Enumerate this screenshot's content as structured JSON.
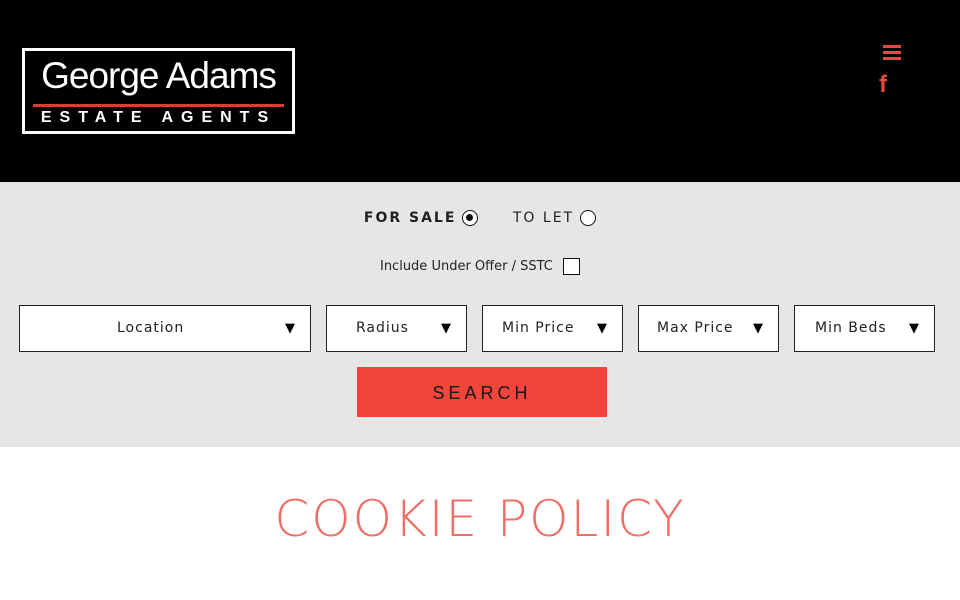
{
  "header": {
    "logo_line1": "George Adams",
    "logo_line2": "ESTATE AGENTS",
    "menu_icon": "hamburger-menu-icon",
    "social_icon": "facebook-icon",
    "social_glyph": "f"
  },
  "search": {
    "tabs": [
      {
        "label": "FOR SALE",
        "selected": true
      },
      {
        "label": "TO LET",
        "selected": false
      }
    ],
    "under_offer_label": "Include Under Offer / SSTC",
    "fields": {
      "location": "Location",
      "radius": "Radius",
      "min_price": "Min Price",
      "max_price": "Max Price",
      "min_beds": "Min Beds"
    },
    "arrow": "▼",
    "search_button": "SEARCH"
  },
  "main": {
    "title": "COOKIE POLICY"
  },
  "colors": {
    "accent": "#ef453b",
    "header_bg": "#000000",
    "panel_bg": "#e6e6e6",
    "title": "#ef6f66"
  }
}
